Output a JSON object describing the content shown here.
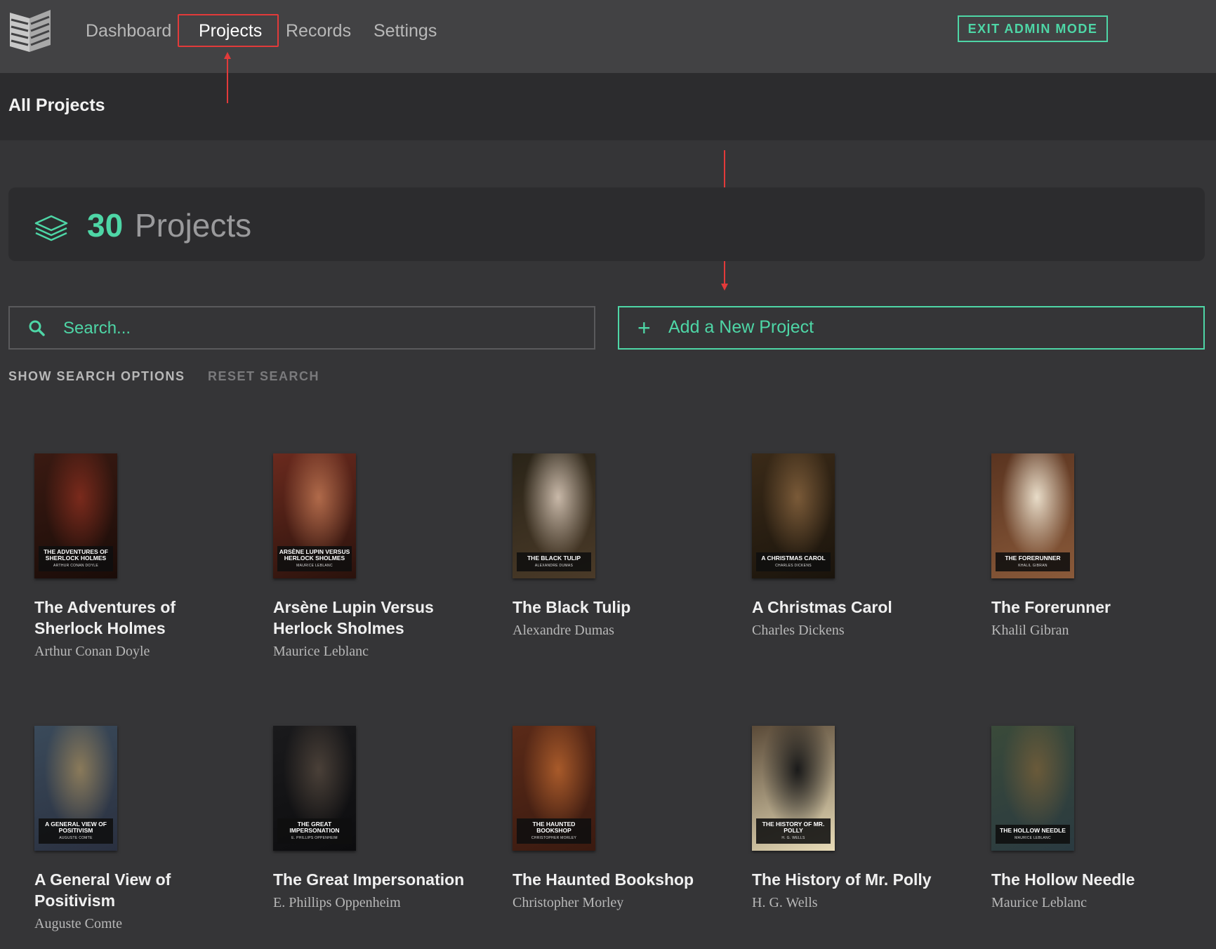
{
  "nav": {
    "logo_icon": "book-pages-logo-icon",
    "links": [
      {
        "label": "Dashboard",
        "active": false
      },
      {
        "label": "Projects",
        "active": true
      },
      {
        "label": "Records",
        "active": false
      },
      {
        "label": "Settings",
        "active": false
      }
    ],
    "exit_label": "EXIT ADMIN MODE"
  },
  "header": {
    "title": "All Projects"
  },
  "summary": {
    "icon": "layers-icon",
    "count": "30",
    "label": "Projects"
  },
  "search": {
    "icon": "search-icon",
    "placeholder": "Search..."
  },
  "add_project": {
    "icon": "plus-icon",
    "label": "Add a New Project"
  },
  "search_options": {
    "show_label": "SHOW SEARCH OPTIONS",
    "reset_label": "RESET SEARCH"
  },
  "colors": {
    "accent": "#4ed6a6",
    "annotation": "#e23a3a",
    "background": "#353537",
    "panel": "#2c2c2e",
    "topbar": "#424244"
  },
  "books": [
    {
      "title": "The Adventures of Sherlock Holmes",
      "author": "Arthur Conan Doyle",
      "cover_title": "THE ADVENTURES OF SHERLOCK HOLMES",
      "cover_author": "ARTHUR CONAN DOYLE",
      "cover_colors": [
        "#3a1a12",
        "#7a2a1c",
        "#1a0c08"
      ]
    },
    {
      "title": "Arsène Lupin Versus Herlock Sholmes",
      "author": "Maurice Leblanc",
      "cover_title": "ARSÈNE LUPIN VERSUS HERLOCK SHOLMES",
      "cover_author": "MAURICE LEBLANC",
      "cover_colors": [
        "#6a2a1e",
        "#b06a4a",
        "#2a120c"
      ]
    },
    {
      "title": "The Black Tulip",
      "author": "Alexandre Dumas",
      "cover_title": "THE BLACK TULIP",
      "cover_author": "ALEXANDRE DUMAS",
      "cover_colors": [
        "#2a2418",
        "#c8b8a8",
        "#4a3a28"
      ]
    },
    {
      "title": "A Christmas Carol",
      "author": "Charles Dickens",
      "cover_title": "A CHRISTMAS CAROL",
      "cover_author": "CHARLES DICKENS",
      "cover_colors": [
        "#3a2a18",
        "#7a5a38",
        "#1a140c"
      ]
    },
    {
      "title": "The Forerunner",
      "author": "Khalil Gibran",
      "cover_title": "THE FORERUNNER",
      "cover_author": "KHALIL GIBRAN",
      "cover_colors": [
        "#5a3420",
        "#e8dcc8",
        "#8a5a3a"
      ]
    },
    {
      "title": "A General View of Positivism",
      "author": "Auguste Comte",
      "cover_title": "A GENERAL VIEW OF POSITIVISM",
      "cover_author": "AUGUSTE COMTE",
      "cover_colors": [
        "#3a4a5a",
        "#8a7a5a",
        "#2a3040"
      ]
    },
    {
      "title": "The Great Impersonation",
      "author": "E. Phillips Oppenheim",
      "cover_title": "THE GREAT IMPERSONATION",
      "cover_author": "E. PHILLIPS OPPENHEIM",
      "cover_colors": [
        "#1a1a1c",
        "#4a4038",
        "#0c0c0e"
      ]
    },
    {
      "title": "The Haunted Bookshop",
      "author": "Christopher Morley",
      "cover_title": "THE HAUNTED BOOKSHOP",
      "cover_author": "CHRISTOPHER MORLEY",
      "cover_colors": [
        "#5a2a18",
        "#a85a2a",
        "#3a1a10"
      ]
    },
    {
      "title": "The History of Mr. Polly",
      "author": "H. G. Wells",
      "cover_title": "THE HISTORY OF MR. POLLY",
      "cover_author": "H. G. WELLS",
      "cover_colors": [
        "#5a4a38",
        "#1a1a1a",
        "#e8dcb8"
      ]
    },
    {
      "title": "The Hollow Needle",
      "author": "Maurice Leblanc",
      "cover_title": "THE HOLLOW NEEDLE",
      "cover_author": "MAURICE LEBLANC",
      "cover_colors": [
        "#3a4a3a",
        "#6a5a3a",
        "#2a3a40"
      ]
    }
  ]
}
